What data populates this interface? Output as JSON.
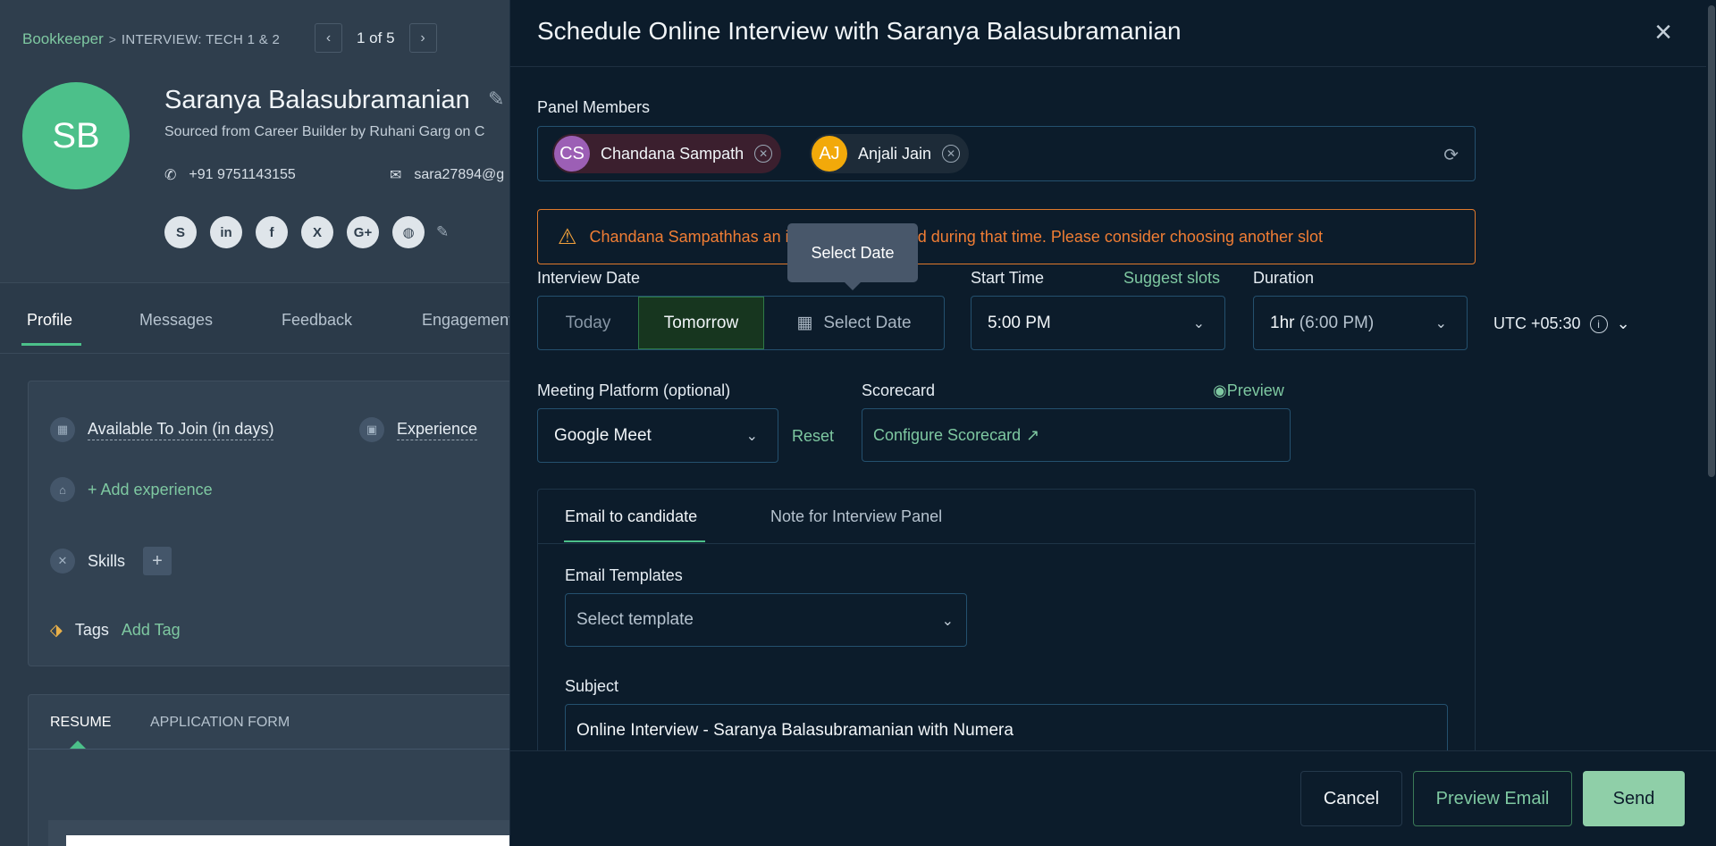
{
  "background": {
    "breadcrumb": {
      "job": "Bookkeeper",
      "separator": ">",
      "stage": "INTERVIEW: TECH 1 & 2"
    },
    "pager": {
      "prev": "‹",
      "text": "1 of 5",
      "next": "›"
    },
    "candidate": {
      "initials": "SB",
      "name": "Saranya Balasubramanian",
      "sourced": "Sourced from Career Builder by Ruhani Garg on C",
      "phone": "+91 9751143155",
      "email": "sara27894@g"
    },
    "socials": [
      "S",
      "in",
      "f",
      "X",
      "G+",
      "◍"
    ],
    "tabs": [
      {
        "label": "Profile"
      },
      {
        "label": "Messages"
      },
      {
        "label": "Feedback"
      },
      {
        "label": "Engagement"
      }
    ],
    "details": {
      "available_label": "Available To Join (in days)",
      "experience_label": "Experience",
      "add_experience": "+ Add experience",
      "skills_label": "Skills",
      "tags_label": "Tags",
      "add_tag": "Add Tag"
    },
    "resume_tabs": {
      "resume": "RESUME",
      "application": "APPLICATION FORM"
    }
  },
  "modal": {
    "title": "Schedule Online Interview with Saranya Balasubramanian",
    "close": "×",
    "panel_members_label": "Panel Members",
    "panel_members": [
      {
        "initials": "CS",
        "name": "Chandana Sampath",
        "color": "#9c5fb5"
      },
      {
        "initials": "AJ",
        "name": "Anjali Jain",
        "color": "#f2a90a"
      }
    ],
    "warning": "Chandana Sampathhas an interview scheduled during that time. Please consider choosing another slot",
    "tooltip": "Select Date",
    "interview_date_label": "Interview Date",
    "date_options": {
      "today": "Today",
      "tomorrow": "Tomorrow",
      "select": "Select Date"
    },
    "start_time_label": "Start Time",
    "suggest_slots": "Suggest slots",
    "start_time_value": "5:00 PM",
    "duration_label": "Duration",
    "duration_value": "1hr",
    "duration_end": "(6:00 PM)",
    "timezone": "UTC +05:30",
    "meeting_platform_label": "Meeting Platform (optional)",
    "meeting_platform_value": "Google Meet",
    "reset": "Reset",
    "scorecard_label": "Scorecard",
    "preview": "Preview",
    "configure_scorecard": "Configure Scorecard",
    "tabs": {
      "email": "Email to candidate",
      "note": "Note for Interview Panel"
    },
    "email_templates_label": "Email Templates",
    "template_placeholder": "Select template",
    "subject_label": "Subject",
    "subject_value": "Online Interview - Saranya Balasubramanian with Numera",
    "footer": {
      "cancel": "Cancel",
      "preview_email": "Preview Email",
      "send": "Send"
    }
  }
}
